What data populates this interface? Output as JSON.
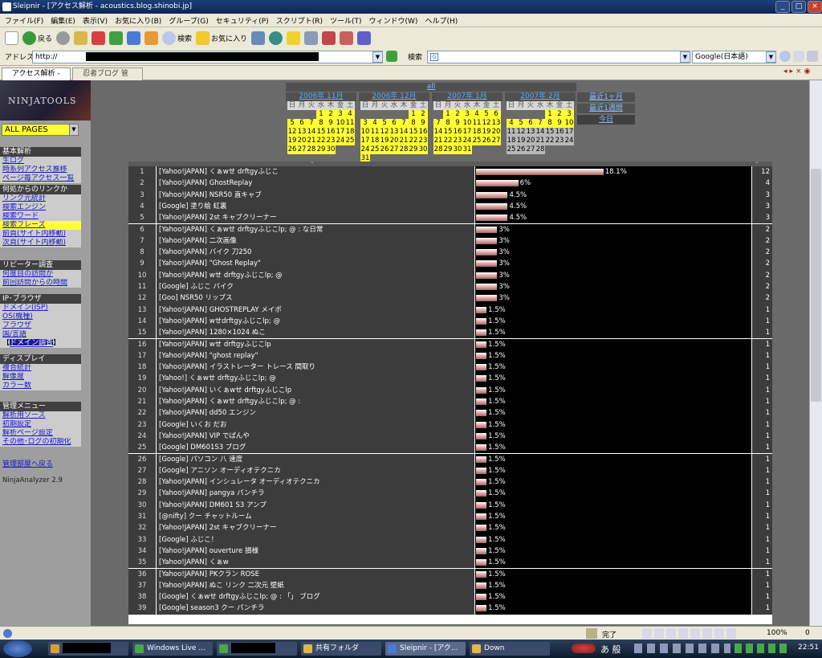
{
  "window": {
    "title": "Sleipnir - [アクセス解析 - acoustics.blog.shinobi.jp]"
  },
  "menu": [
    "ファイル(F)",
    "編集(E)",
    "表示(V)",
    "お気に入り(B)",
    "グループ(G)",
    "セキュリティ(P)",
    "スクリプト(R)",
    "ツール(T)",
    "ウィンドウ(W)",
    "ヘルプ(H)"
  ],
  "toolbar": {
    "back": "戻る",
    "search": "検索",
    "favorites": "お気に入り"
  },
  "address": {
    "label": "アドレス",
    "url": "http://",
    "search_label": "検索",
    "engine": "Google(日本語)"
  },
  "tabs": [
    "アクセス解析 - a...",
    "忍者ブログ 管理..."
  ],
  "sidebar": {
    "logo": "NINJATOOLS",
    "page_select": "ALL PAGES",
    "sections": [
      {
        "title": "基本解析",
        "items": [
          "生ログ",
          "時系列アクセス推移",
          "ページ毎アクセス一覧"
        ]
      },
      {
        "title": "何処からのリンクか",
        "items": [
          "リンク元統計",
          "検索エンジン",
          "検索ワード",
          "検索フレーズ",
          "前頁(サイト内移動)",
          "次頁(サイト内移動)"
        ]
      },
      {
        "title": "リピーター調査",
        "items": [
          "何度目の訪問か",
          "前回訪問からの時間"
        ]
      },
      {
        "title": "IP･ブラウザ",
        "items": [
          "ドメイン(ISP)",
          "OS(機種)",
          "ブラウザ",
          "国/言語",
          "ドメイン調査"
        ]
      },
      {
        "title": "ディスプレイ",
        "items": [
          "複合統計",
          "解像度",
          "カラー数"
        ]
      },
      {
        "title": "管理メニュー",
        "items": [
          "解析用ソース",
          "初期設定",
          "解析ページ設定",
          "その他･ログの初期化"
        ]
      }
    ],
    "back_link": "管理部屋へ戻る",
    "version": "NinjaAnalyzer 2.9"
  },
  "calendar": {
    "all": "all",
    "weekdays": [
      "日",
      "月",
      "火",
      "水",
      "木",
      "金",
      "土"
    ],
    "months": [
      {
        "title": "2006年 11月",
        "offset": 3,
        "days": 30,
        "active_to": 30
      },
      {
        "title": "2006年 12月",
        "offset": 5,
        "days": 31,
        "active_to": 31
      },
      {
        "title": "2007年 1月",
        "offset": 1,
        "days": 31,
        "active_to": 31
      },
      {
        "title": "2007年 2月",
        "offset": 4,
        "days": 28,
        "active_to": 10
      }
    ],
    "ranges": [
      "最近1ヶ月",
      "最近1週間",
      "今日"
    ]
  },
  "chart_data": {
    "type": "table",
    "columns": [
      "#",
      "phrase",
      "share",
      "count"
    ],
    "rows": [
      {
        "rank": "1",
        "phrase": "[Yahoo!JAPAN] くぁwせ drftgyふじこ",
        "pct": 18.1,
        "label": "18.1%",
        "count": "12"
      },
      {
        "rank": "2",
        "phrase": "[Yahoo!JAPAN] GhostReplay",
        "pct": 6,
        "label": "6%",
        "count": "4"
      },
      {
        "rank": "3",
        "phrase": "[Yahoo!JAPAN] NSR50 直キャブ",
        "pct": 4.5,
        "label": "4.5%",
        "count": "3"
      },
      {
        "rank": "4",
        "phrase": "[Google] 塗り絵 虹裏",
        "pct": 4.5,
        "label": "4.5%",
        "count": "3"
      },
      {
        "rank": "5",
        "phrase": "[Yahoo!JAPAN] 2st キャブクリーナー",
        "pct": 4.5,
        "label": "4.5%",
        "count": "3"
      },
      {
        "rank": "6",
        "phrase": "[Yahoo!JAPAN] くぁwせ drftgyふじこlp; @ : な日常",
        "pct": 3,
        "label": "3%",
        "count": "2"
      },
      {
        "rank": "7",
        "phrase": "[Yahoo!JAPAN] 二次画像",
        "pct": 3,
        "label": "3%",
        "count": "2"
      },
      {
        "rank": "8",
        "phrase": "[Yahoo!JAPAN] バイク 刀250",
        "pct": 3,
        "label": "3%",
        "count": "2"
      },
      {
        "rank": "9",
        "phrase": "[Yahoo!JAPAN] \"Ghost Replay\"",
        "pct": 3,
        "label": "3%",
        "count": "2"
      },
      {
        "rank": "10",
        "phrase": "[Yahoo!JAPAN] wせ drftgyふじこlp; @",
        "pct": 3,
        "label": "3%",
        "count": "2"
      },
      {
        "rank": "11",
        "phrase": "[Google] ふじこ バイク",
        "pct": 3,
        "label": "3%",
        "count": "2"
      },
      {
        "rank": "12",
        "phrase": "[Goo] NSR50 リップス",
        "pct": 3,
        "label": "3%",
        "count": "2"
      },
      {
        "rank": "13",
        "phrase": "[Yahoo!JAPAN] GHOSTREPLAY メイポ",
        "pct": 1.5,
        "label": "1.5%",
        "count": "1"
      },
      {
        "rank": "14",
        "phrase": "[Yahoo!JAPAN] wせdrftgyふじこlp; @",
        "pct": 1.5,
        "label": "1.5%",
        "count": "1"
      },
      {
        "rank": "15",
        "phrase": "[Yahoo!JAPAN] 1280×1024 ぬこ",
        "pct": 1.5,
        "label": "1.5%",
        "count": "1"
      },
      {
        "rank": "16",
        "phrase": "[Yahoo!JAPAN] wせ drftgyふじこlp",
        "pct": 1.5,
        "label": "1.5%",
        "count": "1"
      },
      {
        "rank": "17",
        "phrase": "[Yahoo!JAPAN] \"ghost replay\"",
        "pct": 1.5,
        "label": "1.5%",
        "count": "1"
      },
      {
        "rank": "18",
        "phrase": "[Yahoo!JAPAN] イラストレーター トレース 間取り",
        "pct": 1.5,
        "label": "1.5%",
        "count": "1"
      },
      {
        "rank": "19",
        "phrase": "[Yahoo!] くぁwせ drftgyふじこlp; @",
        "pct": 1.5,
        "label": "1.5%",
        "count": "1"
      },
      {
        "rank": "20",
        "phrase": "[Yahoo!JAPAN] いくぁwせ drftgyふじこlp",
        "pct": 1.5,
        "label": "1.5%",
        "count": "1"
      },
      {
        "rank": "21",
        "phrase": "[Yahoo!JAPAN] くぁwせ drftgyふじこlp; @ :",
        "pct": 1.5,
        "label": "1.5%",
        "count": "1"
      },
      {
        "rank": "22",
        "phrase": "[Yahoo!JAPAN] dd50 エンジン",
        "pct": 1.5,
        "label": "1.5%",
        "count": "1"
      },
      {
        "rank": "23",
        "phrase": "[Google] いくお だお",
        "pct": 1.5,
        "label": "1.5%",
        "count": "1"
      },
      {
        "rank": "24",
        "phrase": "[Yahoo!JAPAN] VIP でぱんや",
        "pct": 1.5,
        "label": "1.5%",
        "count": "1"
      },
      {
        "rank": "25",
        "phrase": "[Google] DM601S3 ブログ",
        "pct": 1.5,
        "label": "1.5%",
        "count": "1"
      },
      {
        "rank": "26",
        "phrase": "[Google] パソコン 八 速度",
        "pct": 1.5,
        "label": "1.5%",
        "count": "1"
      },
      {
        "rank": "27",
        "phrase": "[Google] アニソン オーディオテクニカ",
        "pct": 1.5,
        "label": "1.5%",
        "count": "1"
      },
      {
        "rank": "28",
        "phrase": "[Yahoo!JAPAN] インシュレータ オーディオテクニカ",
        "pct": 1.5,
        "label": "1.5%",
        "count": "1"
      },
      {
        "rank": "29",
        "phrase": "[Yahoo!JAPAN] pangya パンチラ",
        "pct": 1.5,
        "label": "1.5%",
        "count": "1"
      },
      {
        "rank": "30",
        "phrase": "[Yahoo!JAPAN] DM601 S3 アンプ",
        "pct": 1.5,
        "label": "1.5%",
        "count": "1"
      },
      {
        "rank": "31",
        "phrase": "[@nifty] クー チャットルーム",
        "pct": 1.5,
        "label": "1.5%",
        "count": "1"
      },
      {
        "rank": "32",
        "phrase": "[Yahoo!JAPAN] 2st キャブクリーナー",
        "pct": 1.5,
        "label": "1.5%",
        "count": "1"
      },
      {
        "rank": "33",
        "phrase": "[Google] ふじこ！",
        "pct": 1.5,
        "label": "1.5%",
        "count": "1"
      },
      {
        "rank": "34",
        "phrase": "[Yahoo!JAPAN] ouverture 損様",
        "pct": 1.5,
        "label": "1.5%",
        "count": "1"
      },
      {
        "rank": "35",
        "phrase": "[Yahoo!JAPAN] くぁw",
        "pct": 1.5,
        "label": "1.5%",
        "count": "1"
      },
      {
        "rank": "36",
        "phrase": "[Yahoo!JAPAN] PKクラン ROSE",
        "pct": 1.5,
        "label": "1.5%",
        "count": "1"
      },
      {
        "rank": "37",
        "phrase": "[Yahoo!JAPAN] ぬこ リンク 二次元 壁紙",
        "pct": 1.5,
        "label": "1.5%",
        "count": "1"
      },
      {
        "rank": "38",
        "phrase": "[Google] くぁwせ drftgyふじこlp; @ : 「」 ブログ",
        "pct": 1.5,
        "label": "1.5%",
        "count": "1"
      },
      {
        "rank": "39",
        "phrase": "[Google] season3 クー パンチラ",
        "pct": 1.5,
        "label": "1.5%",
        "count": "1"
      }
    ]
  },
  "status": {
    "text": "完了",
    "zoom": "100%",
    "count": "0"
  },
  "taskbar": {
    "buttons": [
      "Windows Live ...",
      "共有フォルダ",
      "Sleipnir - [アク...",
      "Down"
    ],
    "tray_ime": "あ 般",
    "time": "22:51"
  }
}
